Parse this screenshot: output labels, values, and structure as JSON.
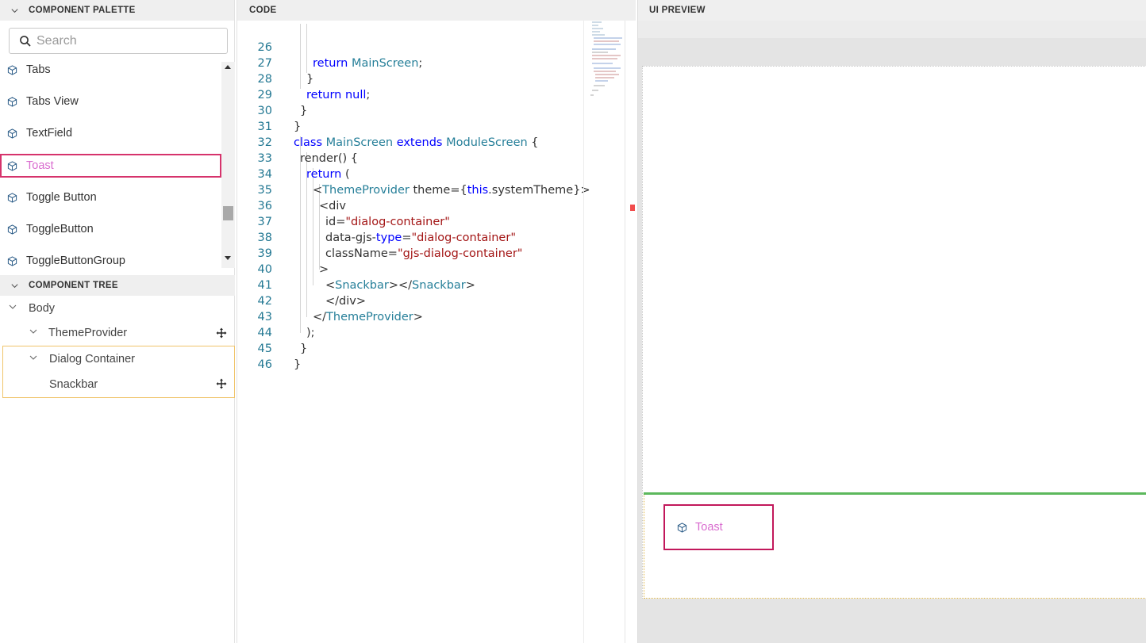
{
  "palette": {
    "header": "COMPONENT PALETTE",
    "search_placeholder": "Search",
    "items": [
      {
        "label": "Tabs"
      },
      {
        "label": "Tabs View"
      },
      {
        "label": "TextField"
      },
      {
        "label": "Toast",
        "selected": true
      },
      {
        "label": "Toggle Button"
      },
      {
        "label": "ToggleButton"
      },
      {
        "label": "ToggleButtonGroup"
      }
    ]
  },
  "tree": {
    "header": "COMPONENT TREE",
    "nodes": [
      {
        "label": "Body",
        "expanded": true
      },
      {
        "label": "ThemeProvider",
        "expanded": true
      },
      {
        "label": "Dialog Container",
        "expanded": true
      },
      {
        "label": "Snackbar"
      }
    ]
  },
  "code": {
    "header": "CODE",
    "lines": [
      {
        "n": "26",
        "src": "return MainScreen;"
      },
      {
        "n": "27",
        "src": "}"
      },
      {
        "n": "28",
        "src": "return null;"
      },
      {
        "n": "29",
        "src": "}"
      },
      {
        "n": "30",
        "src": "}"
      },
      {
        "n": "31",
        "src": "class MainScreen extends ModuleScreen {"
      },
      {
        "n": "32",
        "src": "render() {"
      },
      {
        "n": "33",
        "src": "return ("
      },
      {
        "n": "34",
        "src": "<ThemeProvider theme={this.systemTheme}>"
      },
      {
        "n": "35",
        "src": "<div"
      },
      {
        "n": "36",
        "src": "id=\"dialog-container\""
      },
      {
        "n": "37",
        "src": "data-gjs-type=\"dialog-container\""
      },
      {
        "n": "38",
        "src": "className=\"gjs-dialog-container\""
      },
      {
        "n": "39",
        "src": ">"
      },
      {
        "n": "40",
        "src": "<Snackbar></Snackbar>"
      },
      {
        "n": "41",
        "src": "</div>"
      },
      {
        "n": "42",
        "src": "</ThemeProvider>"
      },
      {
        "n": "43",
        "src": ");"
      },
      {
        "n": "44",
        "src": "}"
      },
      {
        "n": "45",
        "src": "}"
      },
      {
        "n": "46",
        "src": ""
      }
    ]
  },
  "preview": {
    "header": "UI PREVIEW",
    "toast_label": "Toast"
  },
  "colors": {
    "selection": "#d6336c",
    "selected_text": "#d96bcf",
    "tree_highlight": "#f0c46a",
    "drop_indicator": "#5cb85c"
  },
  "icons": {
    "palette_item": "cube-icon",
    "search": "search-icon",
    "collapse": "chevron-down-icon",
    "move": "move-icon"
  }
}
